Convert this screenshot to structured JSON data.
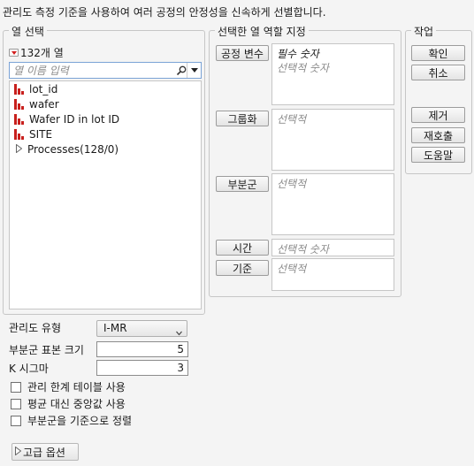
{
  "instruction": "관리도 측정 기준을 사용하여 여러 공정의 안정성을 신속하게 선별합니다.",
  "select_columns": {
    "legend": "열 선택",
    "count_label": "132개 열",
    "search_placeholder": "열 이름 입력",
    "items": [
      {
        "label": "lot_id",
        "icon": "bar-chart-icon"
      },
      {
        "label": "wafer",
        "icon": "bar-chart-icon"
      },
      {
        "label": "Wafer ID in lot ID",
        "icon": "bar-chart-icon"
      },
      {
        "label": "SITE",
        "icon": "bar-chart-icon"
      },
      {
        "label": "Processes(128/0)",
        "icon": "expand-triangle-icon"
      }
    ]
  },
  "roles": {
    "legend": "선택한 열 역할 지정",
    "items": [
      {
        "button": "공정 변수",
        "hints": [
          "필수 숫자",
          "선택적 숫자"
        ]
      },
      {
        "button": "그룹화",
        "hints": [
          "선택적"
        ]
      },
      {
        "button": "부분군",
        "hints": [
          "선택적"
        ]
      },
      {
        "button": "시간",
        "hints": [
          "선택적 숫자"
        ]
      },
      {
        "button": "기준",
        "hints": [
          "선택적"
        ]
      }
    ]
  },
  "actions": {
    "legend": "작업",
    "ok": "확인",
    "cancel": "취소",
    "remove": "제거",
    "recall": "재호출",
    "help": "도움말"
  },
  "options": {
    "chart_type_label": "관리도 유형",
    "chart_type_value": "I-MR",
    "subgroup_size_label": "부분군 표본 크기",
    "subgroup_size_value": "5",
    "k_sigma_label": "K 시그마",
    "k_sigma_value": "3",
    "checkboxes": [
      {
        "label": "관리 한계 테이블 사용",
        "checked": false
      },
      {
        "label": "평균 대신 중앙값 사용",
        "checked": false
      },
      {
        "label": "부분군을 기준으로 정렬",
        "checked": false
      }
    ],
    "advanced_label": "고급 옵션"
  },
  "colors": {
    "accent_red": "#c8201d",
    "focus_blue": "#7aa3d6"
  }
}
